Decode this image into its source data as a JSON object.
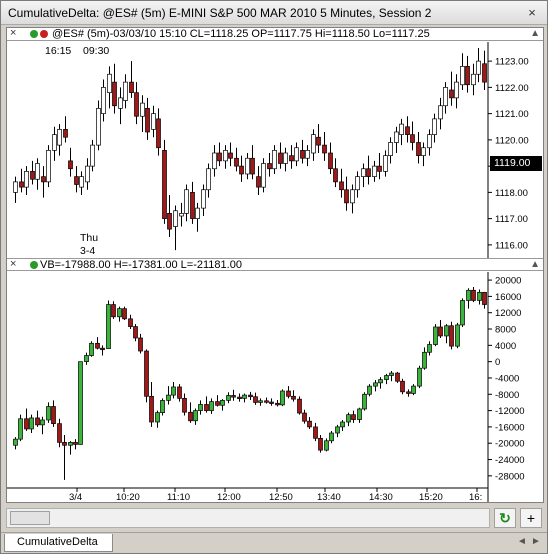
{
  "window": {
    "title": "CumulativeDelta: @ES# (5m) E-MINI S&P 500 MAR 2010 5 Minutes, Session 2",
    "close_symbol": "×"
  },
  "price_pane": {
    "close_symbol": "×",
    "legend": "@ES# (5m)-03/03/10 15:10 CL=1118.25 OP=1117.75 Hi=1118.50 Lo=1117.25",
    "session_top_left": "16:15",
    "session_top_right": "09:30",
    "session_day": "Thu",
    "session_date": "3-4",
    "last_price": "1119.00",
    "resize_symbol": "▲",
    "y_ticks": [
      "1123.00",
      "1122.00",
      "1121.00",
      "1120.00",
      "1119.00",
      "1118.00",
      "1117.00",
      "1116.00"
    ]
  },
  "indicator_pane": {
    "close_symbol": "×",
    "legend": "VB=-17988.00 H=-17381.00 L=-21181.00",
    "resize_symbol": "▲",
    "y_ticks": [
      "20000",
      "16000",
      "12000",
      "8000",
      "4000",
      "0",
      "-4000",
      "-8000",
      "-12000",
      "-16000",
      "-20000",
      "-24000",
      "-28000"
    ]
  },
  "x_axis": {
    "labels": [
      "3/4",
      "10:20",
      "11:10",
      "12:00",
      "12:50",
      "13:40",
      "14:30",
      "15:20",
      "16:"
    ]
  },
  "colors": {
    "price_up_body": "#ffffff",
    "price_down_body": "#a01818",
    "delta_up_body": "#3ab53a",
    "delta_down_body": "#a01818",
    "last_price_bg": "#000000"
  },
  "controls": {
    "refresh_icon": "↻",
    "add_symbol": "+"
  },
  "tabs": {
    "active": "CumulativeDelta",
    "nav_left": "◄",
    "nav_right": "►"
  },
  "chart_data": [
    {
      "type": "candlestick",
      "title": "@ES# (5m) E-MINI S&P 500 MAR 2010",
      "ylim": [
        1115.5,
        1123.5
      ],
      "y_ticks": [
        1116,
        1117,
        1118,
        1119,
        1120,
        1121,
        1122,
        1123
      ],
      "x_labels": [
        "3/4",
        "10:20",
        "11:10",
        "12:00",
        "12:50",
        "13:40",
        "14:30",
        "15:20",
        "16:"
      ],
      "ohlc": [
        [
          1118.0,
          1118.6,
          1117.6,
          1118.4
        ],
        [
          1118.4,
          1118.9,
          1118.0,
          1118.2
        ],
        [
          1118.2,
          1119.0,
          1117.9,
          1118.8
        ],
        [
          1118.8,
          1119.2,
          1118.3,
          1118.5
        ],
        [
          1118.5,
          1119.3,
          1118.1,
          1119.1
        ],
        [
          1118.6,
          1119.0,
          1117.8,
          1118.4
        ],
        [
          1118.4,
          1119.8,
          1118.2,
          1119.6
        ],
        [
          1119.6,
          1120.5,
          1119.2,
          1120.2
        ],
        [
          1119.8,
          1120.6,
          1119.4,
          1120.4
        ],
        [
          1120.4,
          1120.9,
          1119.9,
          1120.1
        ],
        [
          1119.2,
          1119.7,
          1118.6,
          1118.9
        ],
        [
          1118.6,
          1119.0,
          1118.0,
          1118.3
        ],
        [
          1118.2,
          1118.8,
          1117.9,
          1118.6
        ],
        [
          1118.4,
          1119.3,
          1118.1,
          1119.0
        ],
        [
          1119.0,
          1120.0,
          1118.8,
          1119.8
        ],
        [
          1119.8,
          1121.5,
          1119.6,
          1121.2
        ],
        [
          1121.0,
          1122.3,
          1120.7,
          1122.0
        ],
        [
          1121.8,
          1122.8,
          1121.2,
          1122.5
        ],
        [
          1122.2,
          1122.9,
          1121.0,
          1121.3
        ],
        [
          1121.2,
          1122.0,
          1120.6,
          1121.6
        ],
        [
          1121.5,
          1122.5,
          1121.2,
          1122.2
        ],
        [
          1122.2,
          1123.0,
          1121.6,
          1121.8
        ],
        [
          1121.8,
          1122.2,
          1120.6,
          1120.9
        ],
        [
          1120.9,
          1121.7,
          1120.3,
          1121.4
        ],
        [
          1121.2,
          1121.6,
          1120.0,
          1120.3
        ],
        [
          1120.4,
          1121.3,
          1120.1,
          1121.0
        ],
        [
          1120.8,
          1121.2,
          1119.4,
          1119.7
        ],
        [
          1119.6,
          1120.0,
          1116.8,
          1117.0
        ],
        [
          1117.2,
          1117.9,
          1116.3,
          1116.6
        ],
        [
          1116.7,
          1117.5,
          1115.8,
          1117.3
        ],
        [
          1117.1,
          1117.6,
          1116.7,
          1117.2
        ],
        [
          1117.2,
          1118.3,
          1116.9,
          1118.1
        ],
        [
          1118.0,
          1118.4,
          1116.8,
          1117.0
        ],
        [
          1117.0,
          1117.6,
          1116.5,
          1117.4
        ],
        [
          1117.4,
          1118.3,
          1117.1,
          1118.1
        ],
        [
          1118.1,
          1119.1,
          1117.8,
          1118.9
        ],
        [
          1118.9,
          1119.8,
          1118.6,
          1119.5
        ],
        [
          1119.5,
          1119.9,
          1119.0,
          1119.2
        ],
        [
          1119.2,
          1119.8,
          1118.9,
          1119.6
        ],
        [
          1119.5,
          1119.9,
          1119.0,
          1119.3
        ],
        [
          1119.3,
          1119.7,
          1118.8,
          1119.0
        ],
        [
          1119.0,
          1119.4,
          1118.4,
          1118.7
        ],
        [
          1118.7,
          1119.5,
          1118.5,
          1119.3
        ],
        [
          1119.3,
          1119.8,
          1118.5,
          1118.7
        ],
        [
          1118.6,
          1119.0,
          1117.9,
          1118.2
        ],
        [
          1118.2,
          1119.3,
          1118.0,
          1119.1
        ],
        [
          1119.1,
          1119.5,
          1118.6,
          1118.9
        ],
        [
          1118.9,
          1119.8,
          1118.7,
          1119.6
        ],
        [
          1119.5,
          1119.9,
          1118.9,
          1119.1
        ],
        [
          1119.1,
          1119.7,
          1118.8,
          1119.5
        ],
        [
          1119.4,
          1119.8,
          1118.9,
          1119.2
        ],
        [
          1119.2,
          1119.9,
          1119.0,
          1119.7
        ],
        [
          1119.6,
          1120.0,
          1119.1,
          1119.3
        ],
        [
          1119.3,
          1119.8,
          1119.0,
          1119.6
        ],
        [
          1119.5,
          1120.4,
          1119.2,
          1120.2
        ],
        [
          1120.1,
          1120.6,
          1119.5,
          1119.8
        ],
        [
          1119.8,
          1120.3,
          1119.2,
          1119.5
        ],
        [
          1119.5,
          1119.9,
          1118.7,
          1118.9
        ],
        [
          1118.9,
          1119.3,
          1118.2,
          1118.4
        ],
        [
          1118.4,
          1118.9,
          1117.8,
          1118.1
        ],
        [
          1118.1,
          1118.6,
          1117.3,
          1117.6
        ],
        [
          1117.6,
          1118.3,
          1117.2,
          1118.1
        ],
        [
          1118.1,
          1118.8,
          1117.8,
          1118.6
        ],
        [
          1118.6,
          1119.1,
          1118.2,
          1118.9
        ],
        [
          1118.9,
          1119.4,
          1118.3,
          1118.6
        ],
        [
          1118.6,
          1119.2,
          1118.4,
          1119.0
        ],
        [
          1119.0,
          1119.5,
          1118.5,
          1118.8
        ],
        [
          1118.8,
          1119.6,
          1118.6,
          1119.4
        ],
        [
          1119.4,
          1120.1,
          1119.1,
          1119.9
        ],
        [
          1119.9,
          1120.5,
          1119.5,
          1120.3
        ],
        [
          1120.2,
          1120.8,
          1119.8,
          1120.6
        ],
        [
          1120.5,
          1120.9,
          1119.9,
          1120.2
        ],
        [
          1120.2,
          1120.7,
          1119.6,
          1119.9
        ],
        [
          1119.9,
          1120.3,
          1119.1,
          1119.4
        ],
        [
          1119.4,
          1119.9,
          1119.0,
          1119.7
        ],
        [
          1119.7,
          1120.4,
          1119.4,
          1120.2
        ],
        [
          1120.2,
          1121.0,
          1119.9,
          1120.8
        ],
        [
          1120.8,
          1121.6,
          1120.4,
          1121.3
        ],
        [
          1121.3,
          1122.2,
          1121.0,
          1122.0
        ],
        [
          1121.9,
          1122.6,
          1121.3,
          1121.6
        ],
        [
          1121.6,
          1122.5,
          1121.2,
          1122.2
        ],
        [
          1122.1,
          1123.3,
          1121.9,
          1122.8
        ],
        [
          1122.8,
          1123.2,
          1121.8,
          1122.1
        ],
        [
          1122.1,
          1122.9,
          1121.7,
          1122.5
        ],
        [
          1122.5,
          1123.5,
          1122.2,
          1123.0
        ],
        [
          1122.9,
          1123.4,
          1121.9,
          1122.2
        ]
      ]
    },
    {
      "type": "candlestick",
      "title": "Cumulative Delta",
      "ylim": [
        -30000,
        21000
      ],
      "y_ticks": [
        20000,
        16000,
        12000,
        8000,
        4000,
        0,
        -4000,
        -8000,
        -12000,
        -16000,
        -20000,
        -24000,
        -28000
      ],
      "ohlc": [
        [
          -20500,
          -18500,
          -21500,
          -19000
        ],
        [
          -19000,
          -13000,
          -19500,
          -14000
        ],
        [
          -14000,
          -11500,
          -17000,
          -16500
        ],
        [
          -16500,
          -13000,
          -17500,
          -13800
        ],
        [
          -13800,
          -12000,
          -16000,
          -15500
        ],
        [
          -15500,
          -13500,
          -17800,
          -14300
        ],
        [
          -14300,
          -10000,
          -15000,
          -11000
        ],
        [
          -11000,
          -9500,
          -16000,
          -15200
        ],
        [
          -15200,
          -14000,
          -21000,
          -19800
        ],
        [
          -19800,
          -18000,
          -29000,
          -20500
        ],
        [
          -20500,
          -19500,
          -22800,
          -19800
        ],
        [
          -19800,
          -19000,
          -21500,
          -20300
        ],
        [
          -20300,
          0,
          -20300,
          0
        ],
        [
          0,
          2200,
          -800,
          1500
        ],
        [
          1500,
          5000,
          1200,
          4500
        ],
        [
          4500,
          6000,
          3000,
          3300
        ],
        [
          3300,
          4000,
          1500,
          3200
        ],
        [
          3200,
          15000,
          3200,
          14000
        ],
        [
          14000,
          14800,
          10500,
          11000
        ],
        [
          11000,
          13500,
          9800,
          13000
        ],
        [
          13000,
          13500,
          10200,
          10500
        ],
        [
          10500,
          11500,
          8000,
          8600
        ],
        [
          8600,
          9200,
          5000,
          5800
        ],
        [
          5800,
          6800,
          2000,
          2600
        ],
        [
          2600,
          3000,
          -10000,
          -8500
        ],
        [
          -8500,
          -5000,
          -16000,
          -14800
        ],
        [
          -14800,
          -12000,
          -16200,
          -12500
        ],
        [
          -12500,
          -9000,
          -13200,
          -9500
        ],
        [
          -9500,
          -6000,
          -10500,
          -8200
        ],
        [
          -8200,
          -5000,
          -9000,
          -6200
        ],
        [
          -6200,
          -5500,
          -9800,
          -9000
        ],
        [
          -9000,
          -7800,
          -13200,
          -12400
        ],
        [
          -12400,
          -10000,
          -15000,
          -14500
        ],
        [
          -14500,
          -11500,
          -15500,
          -12000
        ],
        [
          -12000,
          -9500,
          -13000,
          -10500
        ],
        [
          -10500,
          -8500,
          -12500,
          -12000
        ],
        [
          -12000,
          -9000,
          -12800,
          -9800
        ],
        [
          -9800,
          -8200,
          -11000,
          -10700
        ],
        [
          -10700,
          -9200,
          -12000,
          -9500
        ],
        [
          -9500,
          -7500,
          -10200,
          -8300
        ],
        [
          -8300,
          -6900,
          -9600,
          -8700
        ],
        [
          -8700,
          -7800,
          -9800,
          -9000
        ],
        [
          -9000,
          -7800,
          -10000,
          -8200
        ],
        [
          -8200,
          -7400,
          -9400,
          -8600
        ],
        [
          -8600,
          -7600,
          -10600,
          -10000
        ],
        [
          -10000,
          -9000,
          -10800,
          -9600
        ],
        [
          -9600,
          -8800,
          -10300,
          -9900
        ],
        [
          -9900,
          -9000,
          -10800,
          -10200
        ],
        [
          -10200,
          -9400,
          -11000,
          -10600
        ],
        [
          -10600,
          -6800,
          -10900,
          -7200
        ],
        [
          -7200,
          -6000,
          -9000,
          -8500
        ],
        [
          -8500,
          -7000,
          -9800,
          -9200
        ],
        [
          -9200,
          -8500,
          -13000,
          -12600
        ],
        [
          -12600,
          -11800,
          -15200,
          -14600
        ],
        [
          -14600,
          -13600,
          -16500,
          -16000
        ],
        [
          -16000,
          -15000,
          -19500,
          -18800
        ],
        [
          -18800,
          -18000,
          -22300,
          -21700
        ],
        [
          -21700,
          -18800,
          -22000,
          -19400
        ],
        [
          -19400,
          -17000,
          -20000,
          -17500
        ],
        [
          -17500,
          -15500,
          -18500,
          -16000
        ],
        [
          -16000,
          -14300,
          -17000,
          -14800
        ],
        [
          -14800,
          -12500,
          -15800,
          -13000
        ],
        [
          -13000,
          -12000,
          -15000,
          -14200
        ],
        [
          -14200,
          -11300,
          -15000,
          -11600
        ],
        [
          -11600,
          -7500,
          -12000,
          -8000
        ],
        [
          -8000,
          -5500,
          -8500,
          -6000
        ],
        [
          -6000,
          -4500,
          -7300,
          -5200
        ],
        [
          -5200,
          -3800,
          -6600,
          -4400
        ],
        [
          -4400,
          -3000,
          -5500,
          -3400
        ],
        [
          -3400,
          -2300,
          -4800,
          -2800
        ],
        [
          -2800,
          -2500,
          -5200,
          -4800
        ],
        [
          -4800,
          -4200,
          -8000,
          -7400
        ],
        [
          -7400,
          -6800,
          -8600,
          -7800
        ],
        [
          -7800,
          -5500,
          -8200,
          -6000
        ],
        [
          -6000,
          -1000,
          -6500,
          -1600
        ],
        [
          -1600,
          3500,
          -2000,
          2300
        ],
        [
          2300,
          5000,
          1500,
          4200
        ],
        [
          4200,
          9200,
          3800,
          8500
        ],
        [
          8500,
          10200,
          5800,
          6300
        ],
        [
          6300,
          9200,
          4500,
          8800
        ],
        [
          8800,
          9800,
          3000,
          3800
        ],
        [
          3800,
          9500,
          3300,
          9000
        ],
        [
          9000,
          15500,
          8500,
          15000
        ],
        [
          15000,
          18000,
          13000,
          17500
        ],
        [
          17500,
          18300,
          14600,
          15000
        ],
        [
          15000,
          17700,
          14000,
          17000
        ],
        [
          17000,
          17000,
          13000,
          14000
        ]
      ]
    }
  ]
}
